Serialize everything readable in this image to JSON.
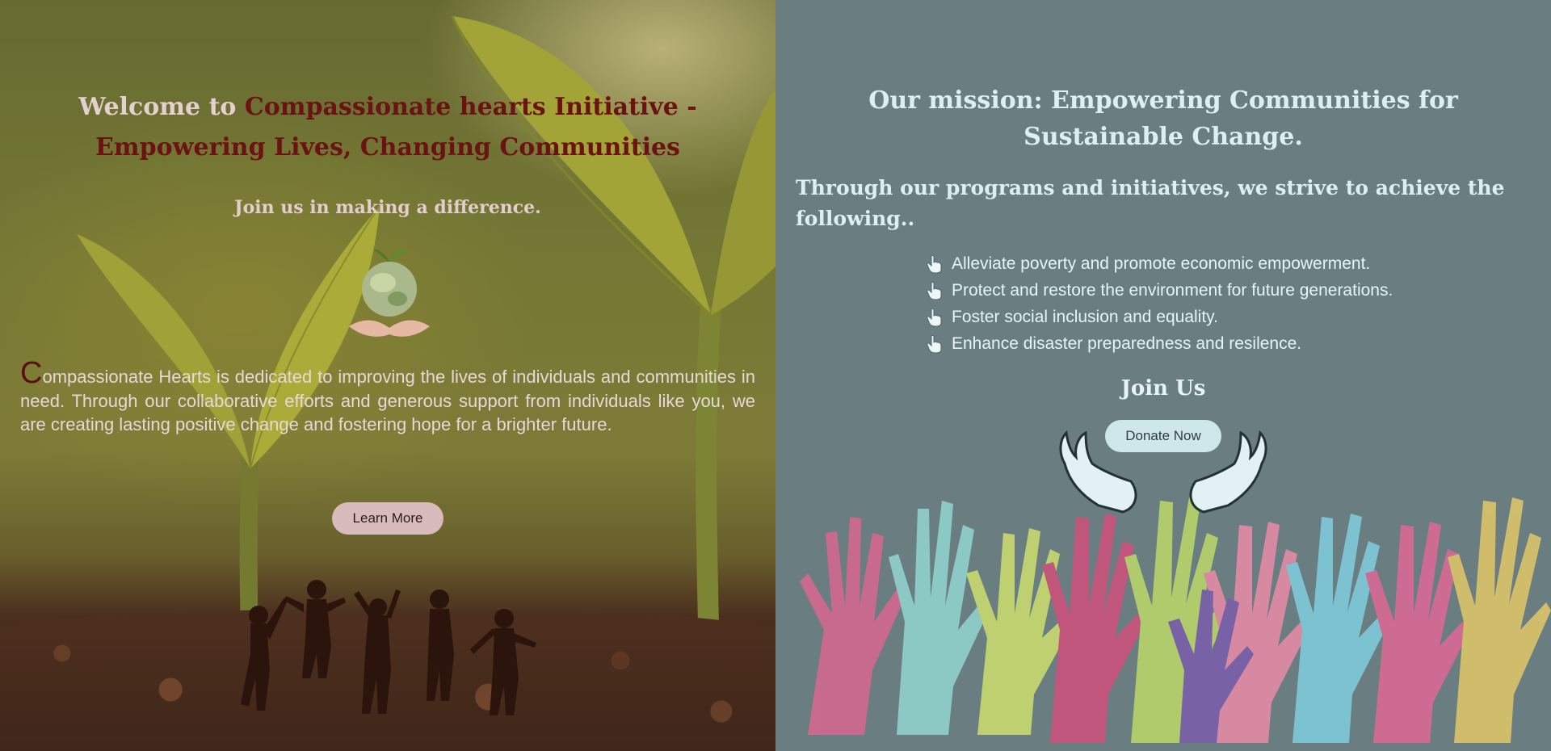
{
  "hero": {
    "title_prefix": "Welcome to ",
    "title_accent": "Compassionate hearts Initiative - Empowering Lives, Changing Communities",
    "subtitle": "Join us in making a difference.",
    "body_dropcap": "C",
    "body_rest": "ompassionate Hearts is dedicated to improving the lives of individuals and communities in need. Through our collaborative efforts and generous support from individuals like you, we are creating lasting positive change and fostering hope for a brighter future.",
    "learn_more_label": "Learn More"
  },
  "mission": {
    "title": "Our mission: Empowering Communities for Sustainable Change.",
    "intro": "Through our programs and initiatives, we strive to achieve the following..",
    "goals": [
      "Alleviate poverty and promote economic empowerment.",
      "Protect and restore the environment for future generations.",
      "Foster social inclusion and equality.",
      "Enhance disaster preparedness and resilence."
    ],
    "goal_icon": "pointing-hand-icon",
    "join_title": "Join Us",
    "donate_label": "Donate Now"
  },
  "colors": {
    "left_accent": "#6b1212",
    "right_background": "#6a7e82",
    "heading_light": "#dcf0f3",
    "learn_button": "#d8bcbc",
    "donate_button": "#cfe6ea"
  }
}
